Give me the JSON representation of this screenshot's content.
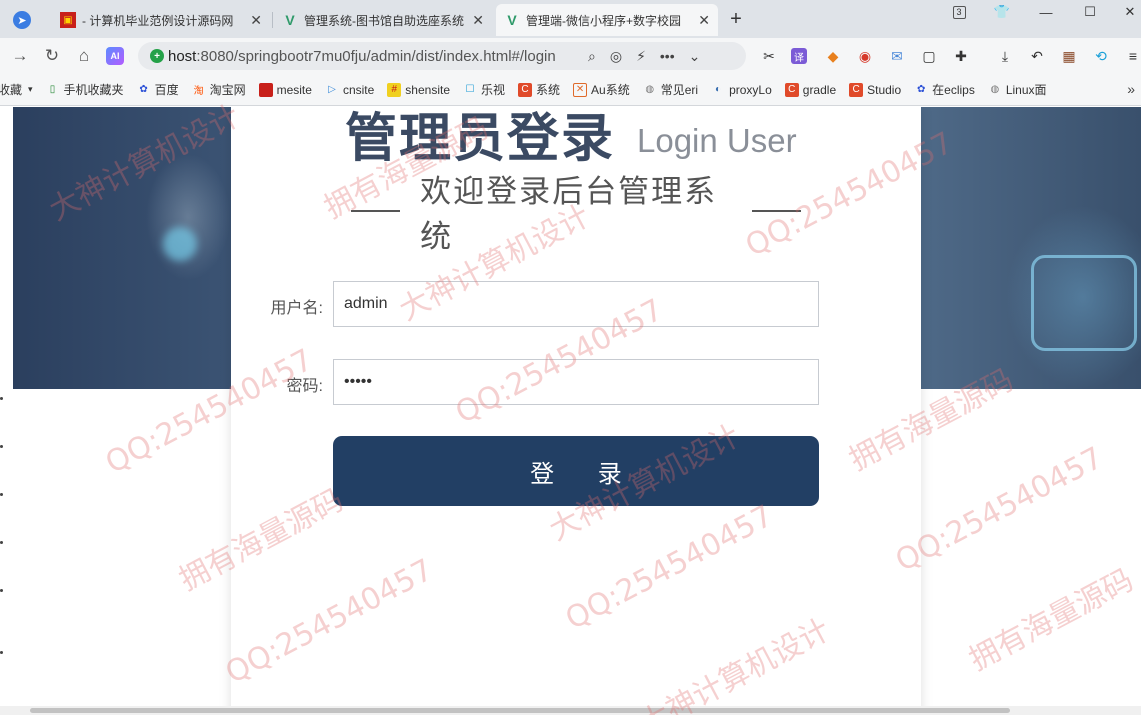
{
  "browser": {
    "tabs": [
      {
        "title": "- 计算机毕业范例设计源码网",
        "favicon": "red-square-icon"
      },
      {
        "title": "管理系统-图书馆自助选座系统",
        "favicon": "vue-logo-icon"
      },
      {
        "title": "管理端-微信小程序+数字校园",
        "favicon": "vue-logo-icon",
        "active": true
      }
    ],
    "tab_count": "3",
    "url_host": "host",
    "url_rest": ":8080/springbootr7mu0fju/admin/dist/index.html#/login",
    "ai_label": "AI",
    "bookmarks": [
      {
        "label": "收藏",
        "icon": "star-icon"
      },
      {
        "label": "手机收藏夹",
        "icon": "phone-icon"
      },
      {
        "label": "百度",
        "icon": "baidu-paw-icon"
      },
      {
        "label": "淘宝网",
        "icon": "taobao-icon"
      },
      {
        "label": "mesite",
        "icon": "red-square-icon"
      },
      {
        "label": "cnsite",
        "icon": "play-icon"
      },
      {
        "label": "shensite",
        "icon": "grid-icon"
      },
      {
        "label": "乐视",
        "icon": "tv-icon"
      },
      {
        "label": "系统",
        "icon": "c-logo-icon"
      },
      {
        "label": "Au系统",
        "icon": "au-icon"
      },
      {
        "label": "常见eri",
        "icon": "globe-icon"
      },
      {
        "label": "proxyLo",
        "icon": "python-icon"
      },
      {
        "label": "gradle",
        "icon": "c-logo-icon"
      },
      {
        "label": "Studio",
        "icon": "c-logo-icon"
      },
      {
        "label": "在eclips",
        "icon": "baidu-paw-icon"
      },
      {
        "label": "Linux面",
        "icon": "globe-icon"
      }
    ]
  },
  "login": {
    "title_zh": "管理员登录",
    "title_en": "Login User",
    "subtitle": "欢迎登录后台管理系统",
    "username_label": "用户名:",
    "username_value": "admin",
    "password_label": "密码:",
    "password_value": "admin",
    "submit_label": "登 录"
  },
  "watermarks": [
    "QQ:254540457",
    "大神计算机设计",
    "拥有海量源码"
  ],
  "colors": {
    "button": "#223f64",
    "title": "#3b4a63",
    "watermark": "#e16e6e"
  }
}
